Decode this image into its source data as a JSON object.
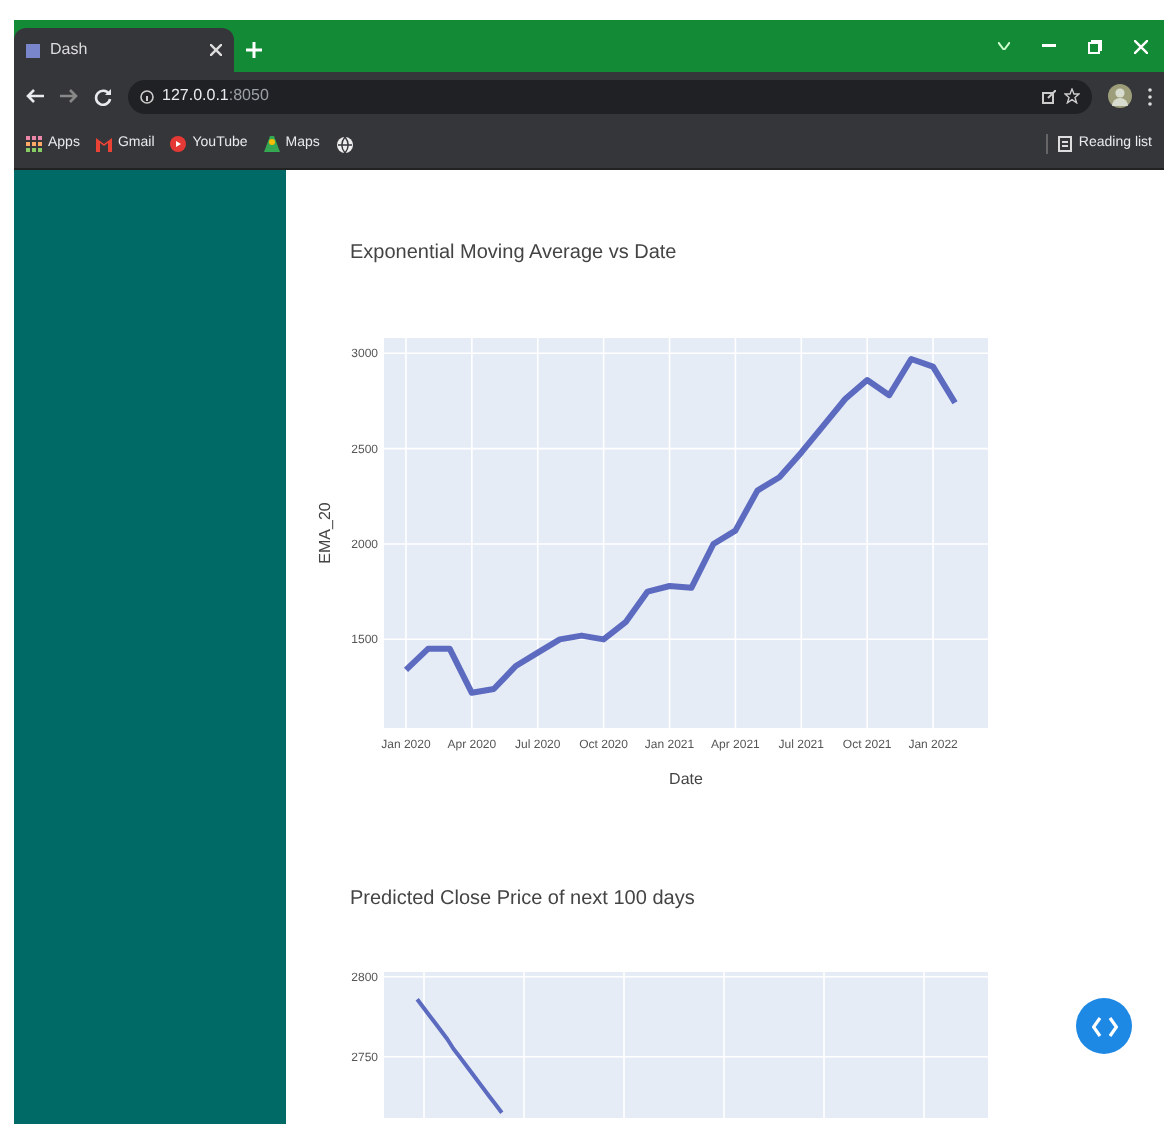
{
  "browser": {
    "tab": {
      "title": "Dash",
      "selected": true
    },
    "address": {
      "host": "127.0.0.1",
      "port": ":8050"
    },
    "bookmarks": [
      {
        "label": "Apps",
        "kind": "apps"
      },
      {
        "label": "Gmail",
        "kind": "gmail"
      },
      {
        "label": "YouTube",
        "kind": "youtube"
      },
      {
        "label": "Maps",
        "kind": "maps"
      }
    ],
    "reading_list": "Reading list"
  },
  "graphs": [
    {
      "title": "Exponential Moving Average vs Date",
      "chart_data": {
        "type": "line",
        "xlabel": "Date",
        "ylabel": "EMA_20",
        "ylim": [
          1035,
          3080
        ],
        "categories": [
          "Jan 2020",
          null,
          null,
          "Apr 2020",
          null,
          null,
          "Jul 2020",
          null,
          null,
          "Oct 2020",
          null,
          null,
          "Jan 2021",
          null,
          null,
          "Apr 2021",
          null,
          null,
          "Jul 2021",
          null,
          null,
          "Oct 2021",
          null,
          null,
          "Jan 2022",
          null
        ],
        "series": [
          {
            "color": "#5c6bc0",
            "values": [
              1340,
              1450,
              1450,
              1220,
              1240,
              1360,
              1430,
              1500,
              1520,
              1500,
              1590,
              1750,
              1780,
              1770,
              2000,
              2070,
              2280,
              2350,
              2480,
              2620,
              2760,
              2860,
              2780,
              2970,
              2930,
              2740
            ]
          }
        ],
        "yticks": [
          1500,
          2000,
          2500,
          3000
        ],
        "grid": true
      }
    },
    {
      "title": "Predicted Close Price of next 100 days",
      "chart_data": {
        "type": "line",
        "ylim": [
          2399,
          2803
        ],
        "categories": [
          null,
          null,
          null,
          null,
          null,
          null,
          null,
          null,
          null,
          null,
          null,
          null,
          null,
          null,
          null,
          null,
          null,
          null,
          null,
          null,
          null,
          null,
          null,
          null,
          null,
          null,
          null,
          null,
          null,
          null,
          null,
          null,
          null,
          null,
          null,
          null,
          null,
          null,
          null,
          null,
          null,
          null,
          null,
          null,
          null,
          null,
          null,
          null,
          null,
          null,
          null,
          null,
          null,
          null,
          null,
          null,
          null,
          null,
          null,
          null,
          null,
          null,
          null,
          null,
          null,
          null,
          null,
          null,
          null,
          null,
          null,
          null,
          null,
          null,
          null,
          null,
          null,
          null,
          null,
          null,
          null,
          null,
          null,
          null,
          null,
          null,
          null,
          null,
          null,
          null,
          null,
          null,
          null,
          null,
          null,
          null,
          null,
          null,
          null,
          null
        ],
        "series": [
          {
            "color": "#5c6bc0",
            "values": [
              null,
              null,
              null,
              null,
              null,
              2786,
              2781,
              2776,
              2771,
              2766,
              2761,
              2755,
              2750,
              2745,
              2740,
              2735,
              2730,
              2725,
              2720,
              2715,
              null,
              null,
              null,
              null,
              null,
              null,
              null,
              null,
              null,
              null,
              null,
              null,
              null,
              null,
              null,
              null,
              null,
              null,
              null,
              null,
              null,
              null,
              null,
              null,
              null,
              null,
              null,
              null,
              null,
              null,
              null,
              null,
              null,
              null,
              null,
              null,
              null,
              null,
              null,
              null,
              null,
              null,
              null,
              null,
              null,
              null,
              null,
              null,
              null,
              null,
              null,
              null,
              null,
              null,
              null,
              null,
              null,
              null,
              null,
              null,
              null,
              null,
              null,
              null,
              null,
              null,
              null,
              null,
              null,
              null,
              null,
              null,
              null,
              null,
              null,
              null,
              null,
              null,
              null,
              null
            ]
          }
        ],
        "yticks": [
          2750,
          2800
        ],
        "grid": true
      }
    }
  ]
}
